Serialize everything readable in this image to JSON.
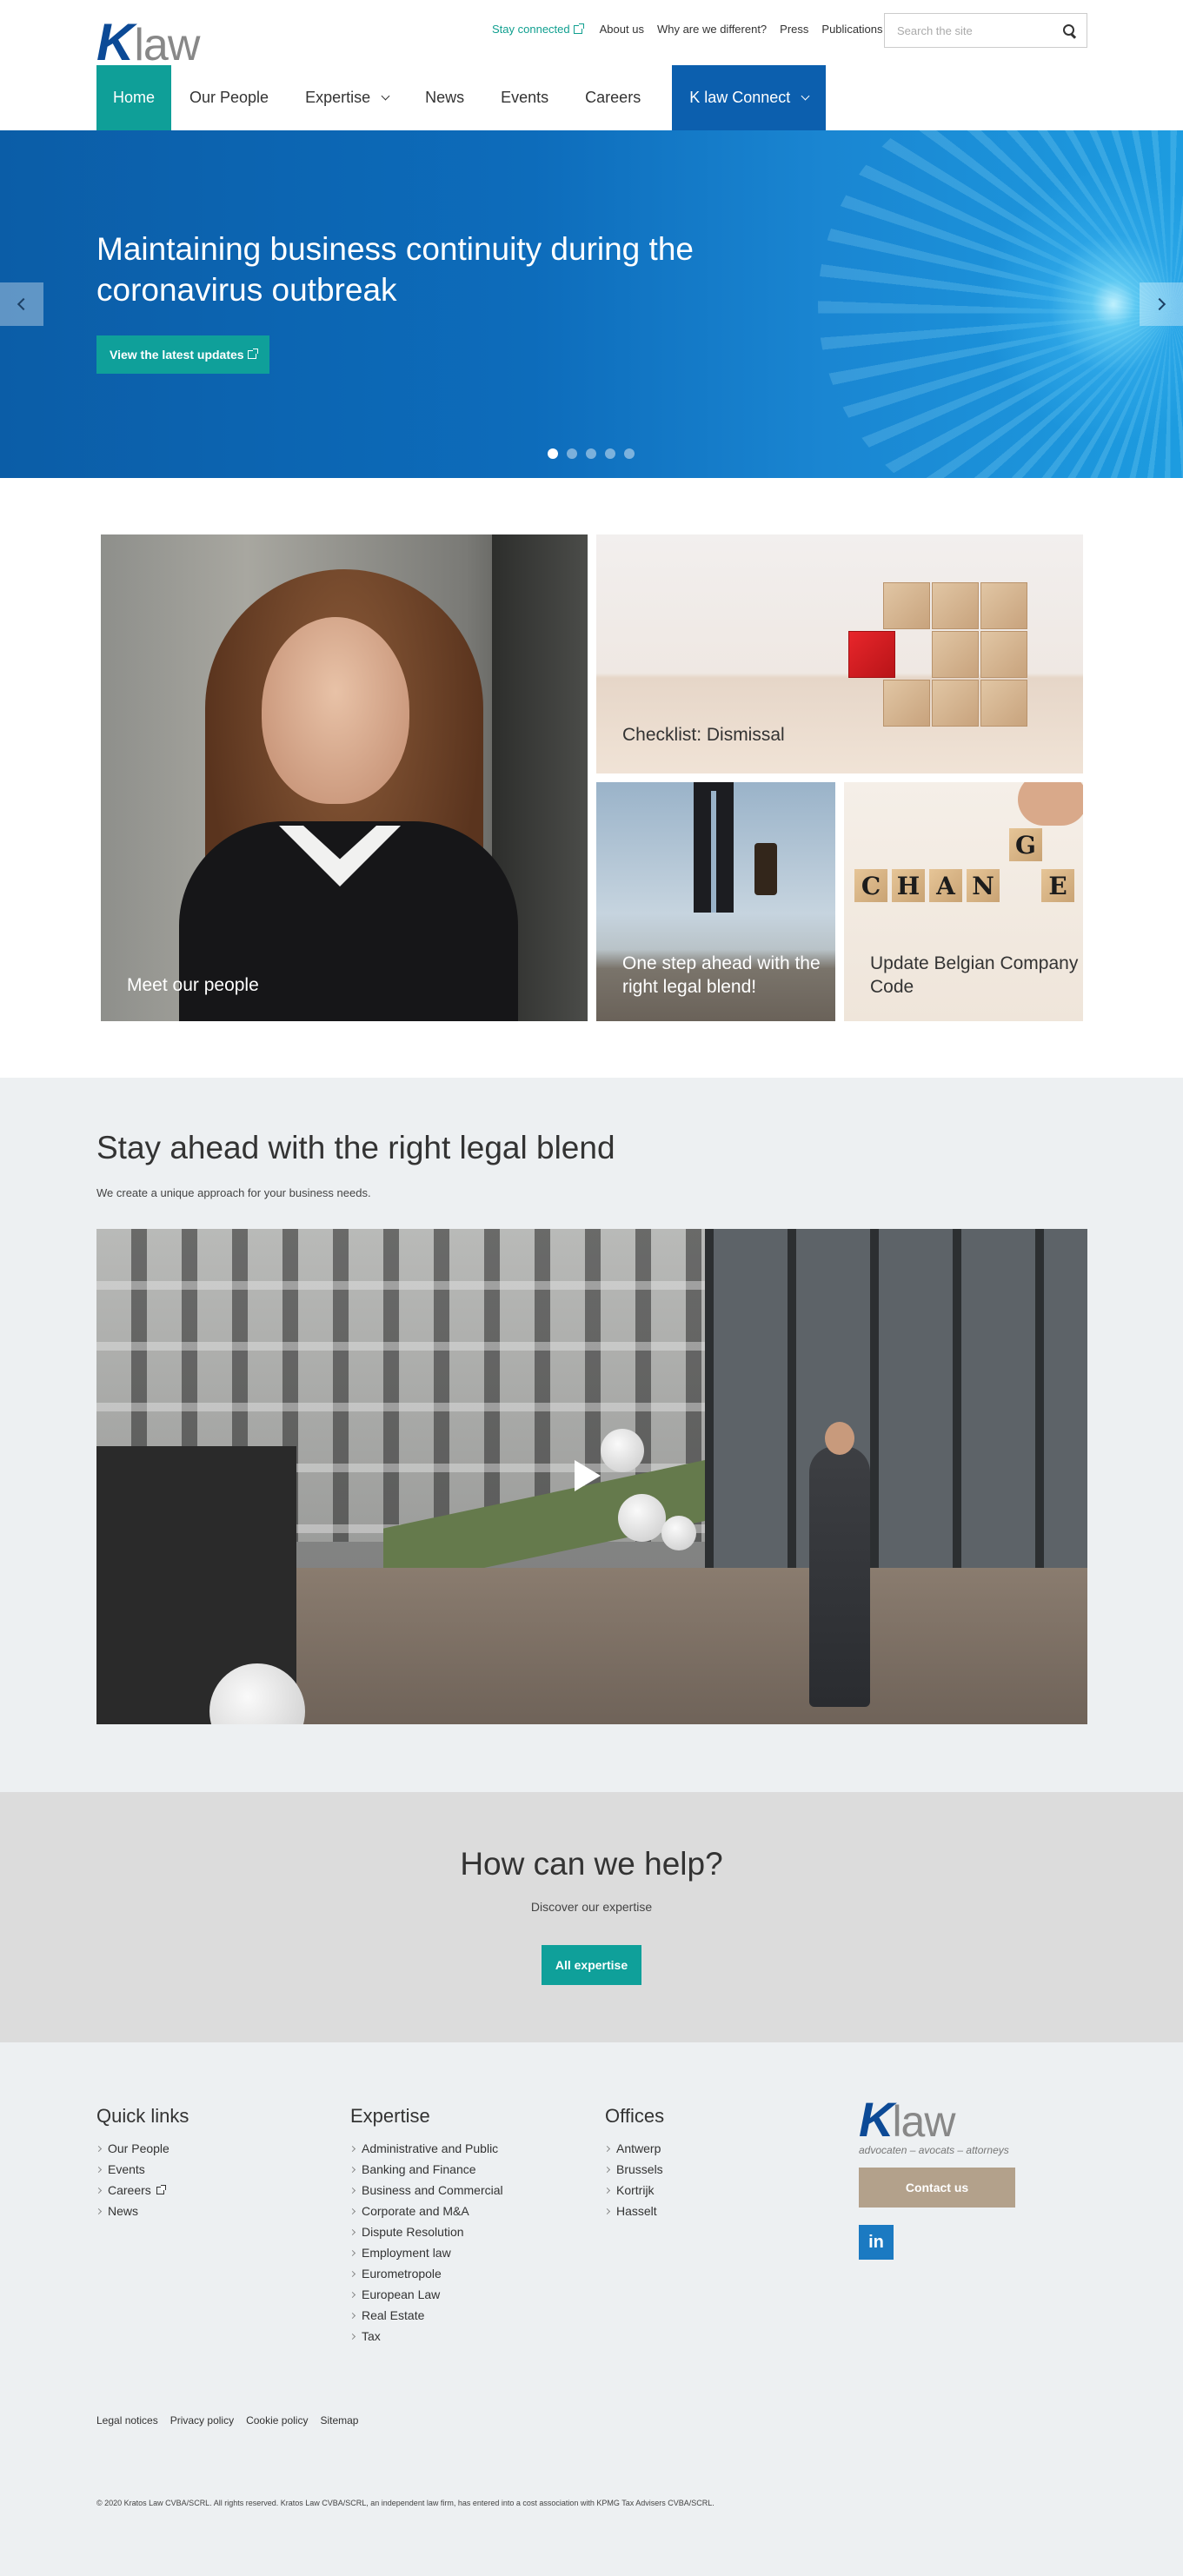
{
  "header": {
    "logo_k": "K",
    "logo_law": "law",
    "stay_connected": "Stay connected",
    "top_links": [
      "About us",
      "Why are we different?",
      "Press",
      "Publications"
    ],
    "search_placeholder": "Search the site",
    "nav": [
      "Home",
      "Our People",
      "Expertise",
      "News",
      "Events",
      "Careers",
      "K law Connect"
    ]
  },
  "hero": {
    "title": "Maintaining business continuity during the coronavirus outbreak",
    "cta": "View the latest updates",
    "slides_total": 5,
    "active_slide": 1
  },
  "tiles": {
    "people": "Meet our people",
    "dismissal": "Checklist: Dismissal",
    "step": "One step ahead with the right legal blend!",
    "change": "Update Belgian Company Code",
    "change_letters": [
      "C",
      "H",
      "A",
      "N",
      "E"
    ],
    "change_g": "G"
  },
  "stay": {
    "title": "Stay ahead with the right legal blend",
    "subtitle": "We create a unique approach for your business needs."
  },
  "help": {
    "title": "How can we help?",
    "subtitle": "Discover our expertise",
    "button": "All expertise"
  },
  "footer": {
    "quick_title": "Quick links",
    "quick_links": [
      "Our People",
      "Events",
      "Careers",
      "News"
    ],
    "expertise_title": "Expertise",
    "expertise_links": [
      "Administrative and Public",
      "Banking and Finance",
      "Business and Commercial",
      "Corporate and M&A",
      "Dispute Resolution",
      "Employment law",
      "Eurometropole",
      "European Law",
      "Real Estate",
      "Tax"
    ],
    "offices_title": "Offices",
    "offices": [
      "Antwerp",
      "Brussels",
      "Kortrijk",
      "Hasselt"
    ],
    "logo_tagline": "advocaten – avocats – attorneys",
    "contact": "Contact us",
    "linkedin": "in",
    "legal": [
      "Legal notices",
      "Privacy policy",
      "Cookie policy",
      "Sitemap"
    ],
    "copyright": "© 2020 Kratos Law CVBA/SCRL. All rights reserved. Kratos Law CVBA/SCRL, an independent law firm, has entered into a cost association with KPMG Tax Advisers CVBA/SCRL."
  },
  "colors": {
    "teal": "#0f9f98",
    "brand_blue": "#0c5fae",
    "contact_tan": "#b3a18b",
    "linkedin": "#1b7ac2"
  }
}
